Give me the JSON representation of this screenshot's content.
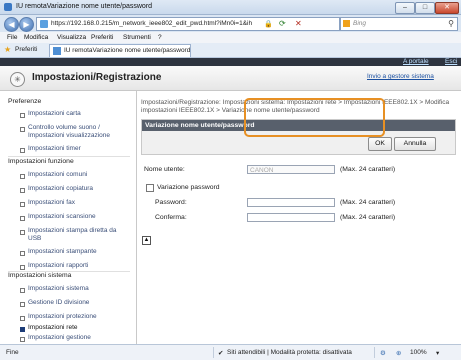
{
  "window": {
    "title": "IU remotaVariazione nome utente/password",
    "controls": {
      "minimize": "–",
      "maximize": "□",
      "close": "✕"
    }
  },
  "browser": {
    "url": "https://192.168.0.215/m_network_ieee802_edit_pwd.html?iMn0i=1&ih",
    "search_placeholder": "Bing",
    "menu": [
      "File",
      "Modifica",
      "Visualizza",
      "Preferiti",
      "Strumenti",
      "?"
    ],
    "favorites_label": "Preferiti",
    "tab_label": "IU remotaVariazione nome utente/password"
  },
  "page": {
    "top_links": {
      "portal": "A portale",
      "logout": "Esci"
    },
    "header_title": "Impostazioni/Registrazione",
    "back_link": "Invio a gestore sistema",
    "breadcrumb": "Impostazioni/Registrazione: Impostazioni sistema: Impostazioni rete > Impostazioni IEEE802.1X > Modifica impostazioni IEEE802.1X > Variazione nome utente/password",
    "panel_title": "Variazione nome utente/password",
    "ok_label": "OK",
    "cancel_label": "Annulla",
    "username_label": "Nome utente:",
    "username_value": "CANON",
    "max_hint": "(Max. 24 caratteri)",
    "change_password_label": "Variazione password",
    "password_label": "Password:",
    "confirm_label": "Conferma:",
    "top_icon": "▲"
  },
  "sidebar": {
    "sections": [
      {
        "heading": "Preferenze",
        "items": [
          "Impostazioni carta",
          "Controllo volume suono / Impostazioni visualizzazione",
          "Impostazioni timer"
        ]
      },
      {
        "heading": "Impostazioni funzione",
        "items": [
          "Impostazioni comuni",
          "Impostazioni copiatura",
          "Impostazioni fax",
          "Impostazioni scansione",
          "Impostazioni stampa diretta da USB",
          "Impostazioni stampante",
          "Impostazioni rapporti"
        ]
      },
      {
        "heading": "Impostazioni sistema",
        "items": [
          "Impostazioni sistema",
          "Gestione ID divisione",
          "Impostazioni protezione",
          "Impostazioni rete",
          "Impostazioni gestione"
        ]
      }
    ],
    "active_item": "Impostazioni rete"
  },
  "statusbar": {
    "left": "Fine",
    "zone": "Siti attendibili | Modalità protetta: disattivata",
    "zoom": "100%"
  }
}
